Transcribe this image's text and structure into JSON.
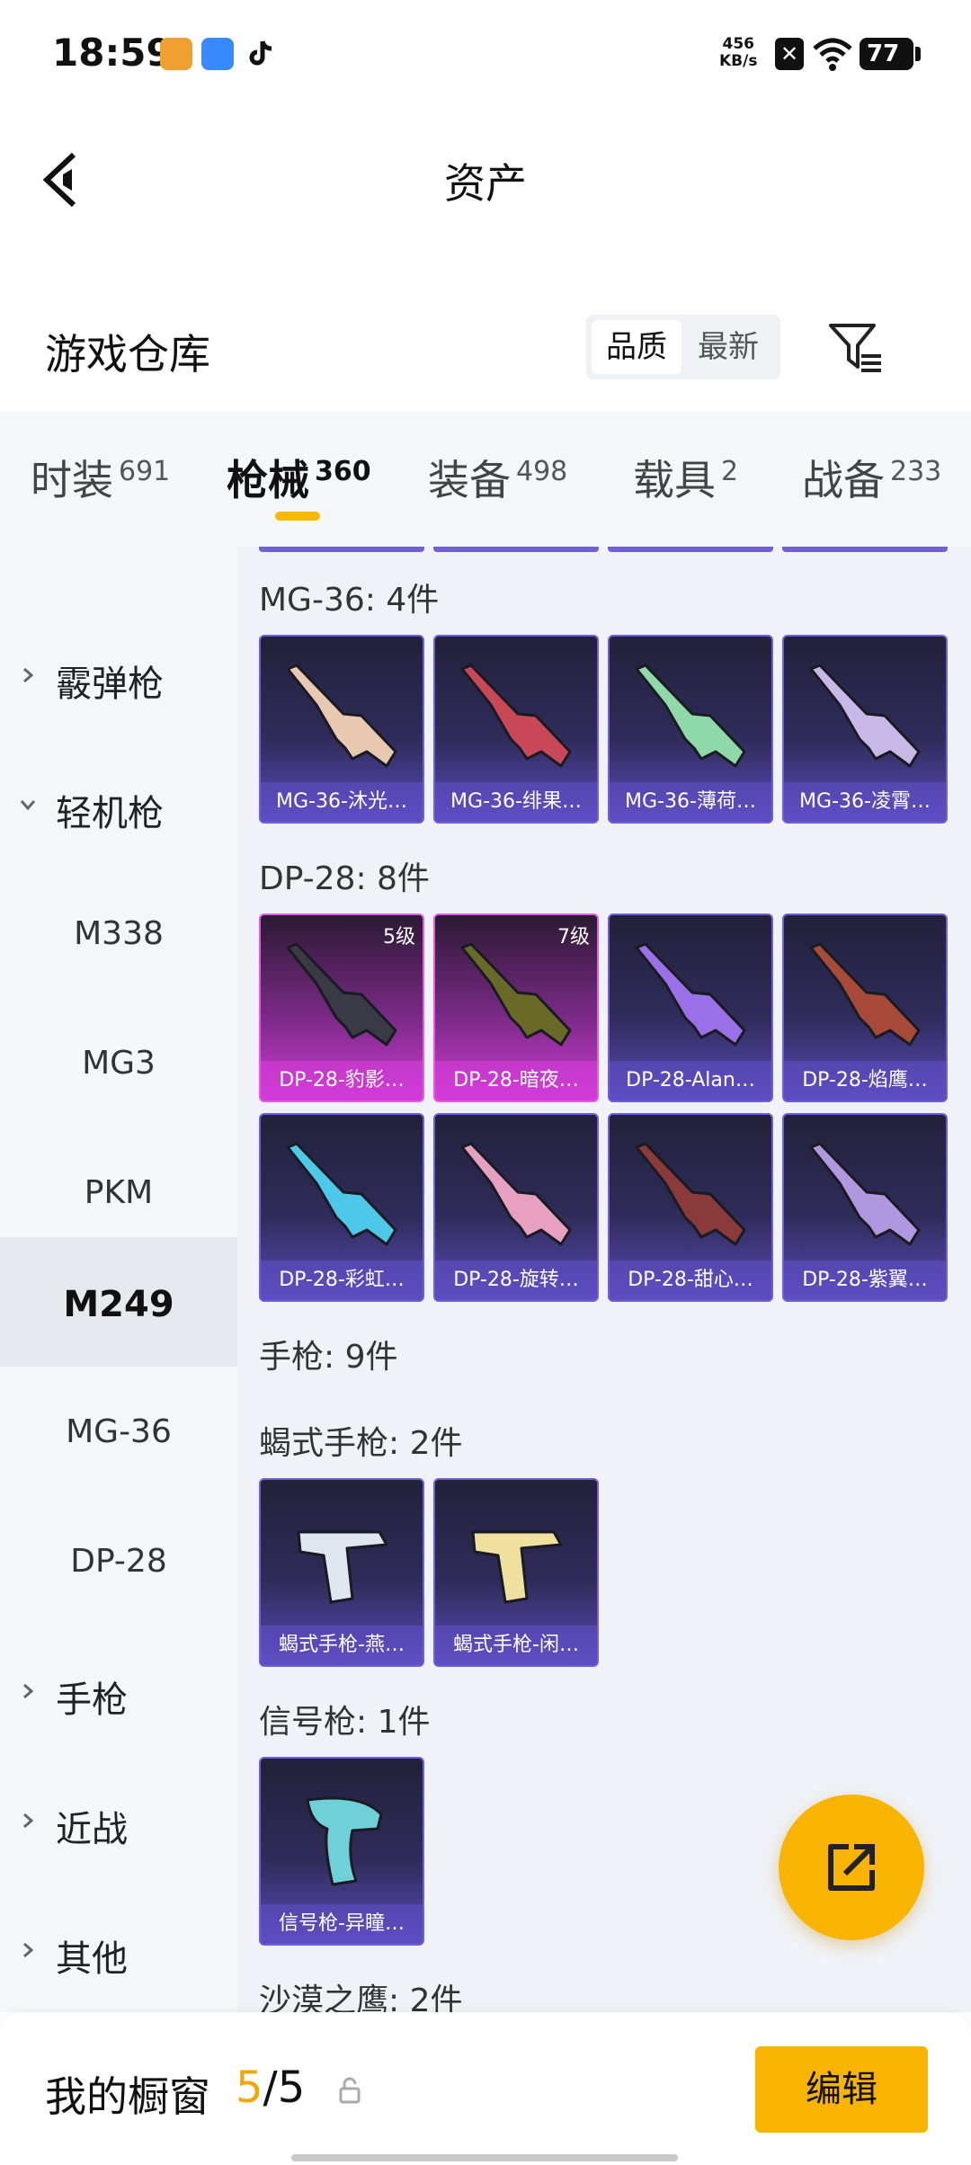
{
  "status_bar": {
    "time": "18:59",
    "net_speed_value": "456",
    "net_speed_unit": "KB/s",
    "battery": "77"
  },
  "header": {
    "title": "资产"
  },
  "warehouse": {
    "title": "游戏仓库",
    "sort_options": [
      "品质",
      "最新"
    ],
    "active_sort": "品质"
  },
  "tabs": [
    {
      "label": "时装",
      "count": "691"
    },
    {
      "label": "枪械",
      "count": "360",
      "active": true
    },
    {
      "label": "装备",
      "count": "498"
    },
    {
      "label": "载具",
      "count": "2"
    },
    {
      "label": "战备",
      "count": "233"
    }
  ],
  "sidebar": {
    "items": [
      {
        "label": "霰弹枪",
        "type": "parent",
        "expanded": false
      },
      {
        "label": "轻机枪",
        "type": "parent",
        "expanded": true
      },
      {
        "label": "M338",
        "type": "child"
      },
      {
        "label": "MG3",
        "type": "child"
      },
      {
        "label": "PKM",
        "type": "child"
      },
      {
        "label": "M249",
        "type": "child",
        "selected": true
      },
      {
        "label": "MG-36",
        "type": "child"
      },
      {
        "label": "DP-28",
        "type": "child"
      },
      {
        "label": "手枪",
        "type": "parent",
        "expanded": false
      },
      {
        "label": "近战",
        "type": "parent",
        "expanded": false
      },
      {
        "label": "其他",
        "type": "parent",
        "expanded": false
      }
    ]
  },
  "groups": [
    {
      "title": "MG-36: 4件",
      "items": [
        {
          "name": "MG-36-沐光…",
          "color": "#e8c8b0"
        },
        {
          "name": "MG-36-绯果…",
          "color": "#c84858"
        },
        {
          "name": "MG-36-薄荷…",
          "color": "#8fd8a8"
        },
        {
          "name": "MG-36-凌霄…",
          "color": "#c8b8e8"
        }
      ]
    },
    {
      "title": "DP-28: 8件",
      "items": [
        {
          "name": "DP-28-豹影…",
          "level": "5级",
          "color": "#3a3a44",
          "rarity": "pink"
        },
        {
          "name": "DP-28-暗夜…",
          "level": "7级",
          "color": "#6a6a28",
          "rarity": "pink"
        },
        {
          "name": "DP-28-Alan…",
          "color": "#9a70e8"
        },
        {
          "name": "DP-28-焰鹰…",
          "color": "#a84a3a"
        },
        {
          "name": "DP-28-彩虹…",
          "color": "#4ec8e8"
        },
        {
          "name": "DP-28-旋转…",
          "color": "#e8a0c0"
        },
        {
          "name": "DP-28-甜心…",
          "color": "#8a3a3a"
        },
        {
          "name": "DP-28-紫翼…",
          "color": "#b098e0"
        }
      ]
    },
    {
      "title": "手枪: 9件",
      "items": []
    },
    {
      "title": "蝎式手枪: 2件",
      "items": [
        {
          "name": "蝎式手枪-燕…",
          "color": "#dfe6ef"
        },
        {
          "name": "蝎式手枪-闲…",
          "color": "#f0e0a0"
        }
      ]
    },
    {
      "title": "信号枪: 1件",
      "items": [
        {
          "name": "信号枪-异瞳…",
          "color": "#6fd0d8"
        }
      ]
    },
    {
      "title": "沙漠之鹰: 2件",
      "items": []
    }
  ],
  "showcase": {
    "label": "我的橱窗",
    "current": "5",
    "total": "5",
    "edit_label": "编辑"
  },
  "colors": {
    "accent": "#f8b400",
    "card_purple": "#5b4bbd",
    "card_pink": "#d13cd6"
  }
}
